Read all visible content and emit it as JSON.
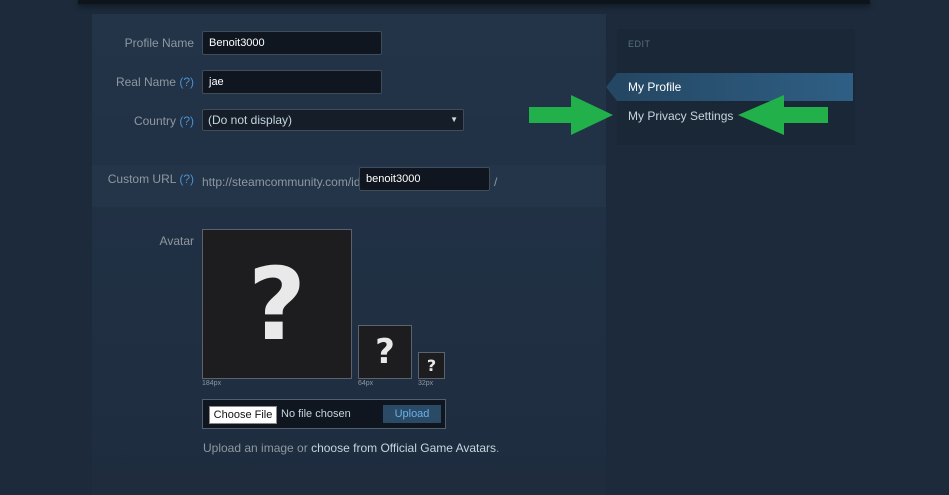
{
  "form": {
    "profile_name_label": "Profile Name",
    "profile_name_value": "Benoit3000",
    "real_name_label": "Real Name",
    "real_name_value": "jae",
    "country_label": "Country",
    "country_value": "(Do not display)",
    "help_mark": "(?)",
    "custom_url_label": "Custom URL",
    "custom_url_prefix": "http://steamcommunity.com/id/",
    "custom_url_value": "benoit3000",
    "custom_url_suffix": "/",
    "avatar_label": "Avatar",
    "avatar_placeholder": "?",
    "sizes": [
      "184px",
      "64px",
      "32px"
    ],
    "choose_file_label": "Choose File",
    "file_status": "No file chosen",
    "upload_label": "Upload",
    "upload_note_prefix": "Upload an image or",
    "upload_note_link": "choose from Official Game Avatars",
    "upload_note_suffix": "."
  },
  "sidebar": {
    "heading": "EDIT",
    "items": [
      {
        "label": "My Profile",
        "active": true
      },
      {
        "label": "My Privacy Settings",
        "active": false
      }
    ]
  },
  "colors": {
    "background": "#1c2a3b",
    "active_item": "#2f5f85",
    "help_link": "#4c8fd0",
    "annotation_arrow": "#22b04b"
  },
  "annotations": [
    "green-arrow-right",
    "green-arrow-left"
  ]
}
